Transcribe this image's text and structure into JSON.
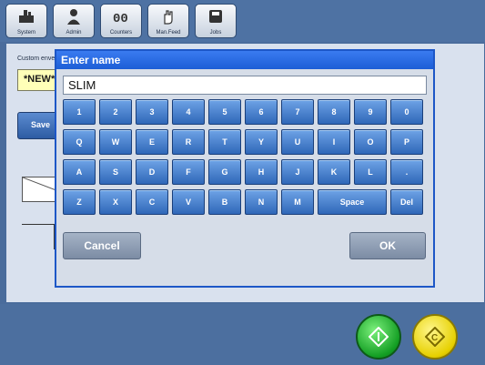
{
  "toolbar": {
    "items": [
      {
        "label": "System",
        "icon": "system-icon"
      },
      {
        "label": "Admin",
        "icon": "admin-icon"
      },
      {
        "label": "Counters",
        "icon": "counters-icon"
      },
      {
        "label": "Man.Feed",
        "icon": "hand-icon"
      },
      {
        "label": "Jobs",
        "icon": "jobs-icon"
      }
    ]
  },
  "main": {
    "left_label": "Custom enve",
    "new_value": "*NEW*",
    "save_label": "Save"
  },
  "dialog": {
    "title": "Enter name",
    "name_value": "SLIM",
    "keys_row1": [
      "1",
      "2",
      "3",
      "4",
      "5",
      "6",
      "7",
      "8",
      "9",
      "0"
    ],
    "keys_row2": [
      "Q",
      "W",
      "E",
      "R",
      "T",
      "Y",
      "U",
      "I",
      "O",
      "P"
    ],
    "keys_row3": [
      "A",
      "S",
      "D",
      "F",
      "G",
      "H",
      "J",
      "K",
      "L",
      "."
    ],
    "keys_row4": [
      "Z",
      "X",
      "C",
      "V",
      "B",
      "N",
      "M",
      "Space",
      "Del"
    ],
    "cancel_label": "Cancel",
    "ok_label": "OK"
  },
  "colors": {
    "accent": "#1d57c7",
    "key": "#2f67b8",
    "go": "#139e23",
    "reset": "#e6d000"
  }
}
